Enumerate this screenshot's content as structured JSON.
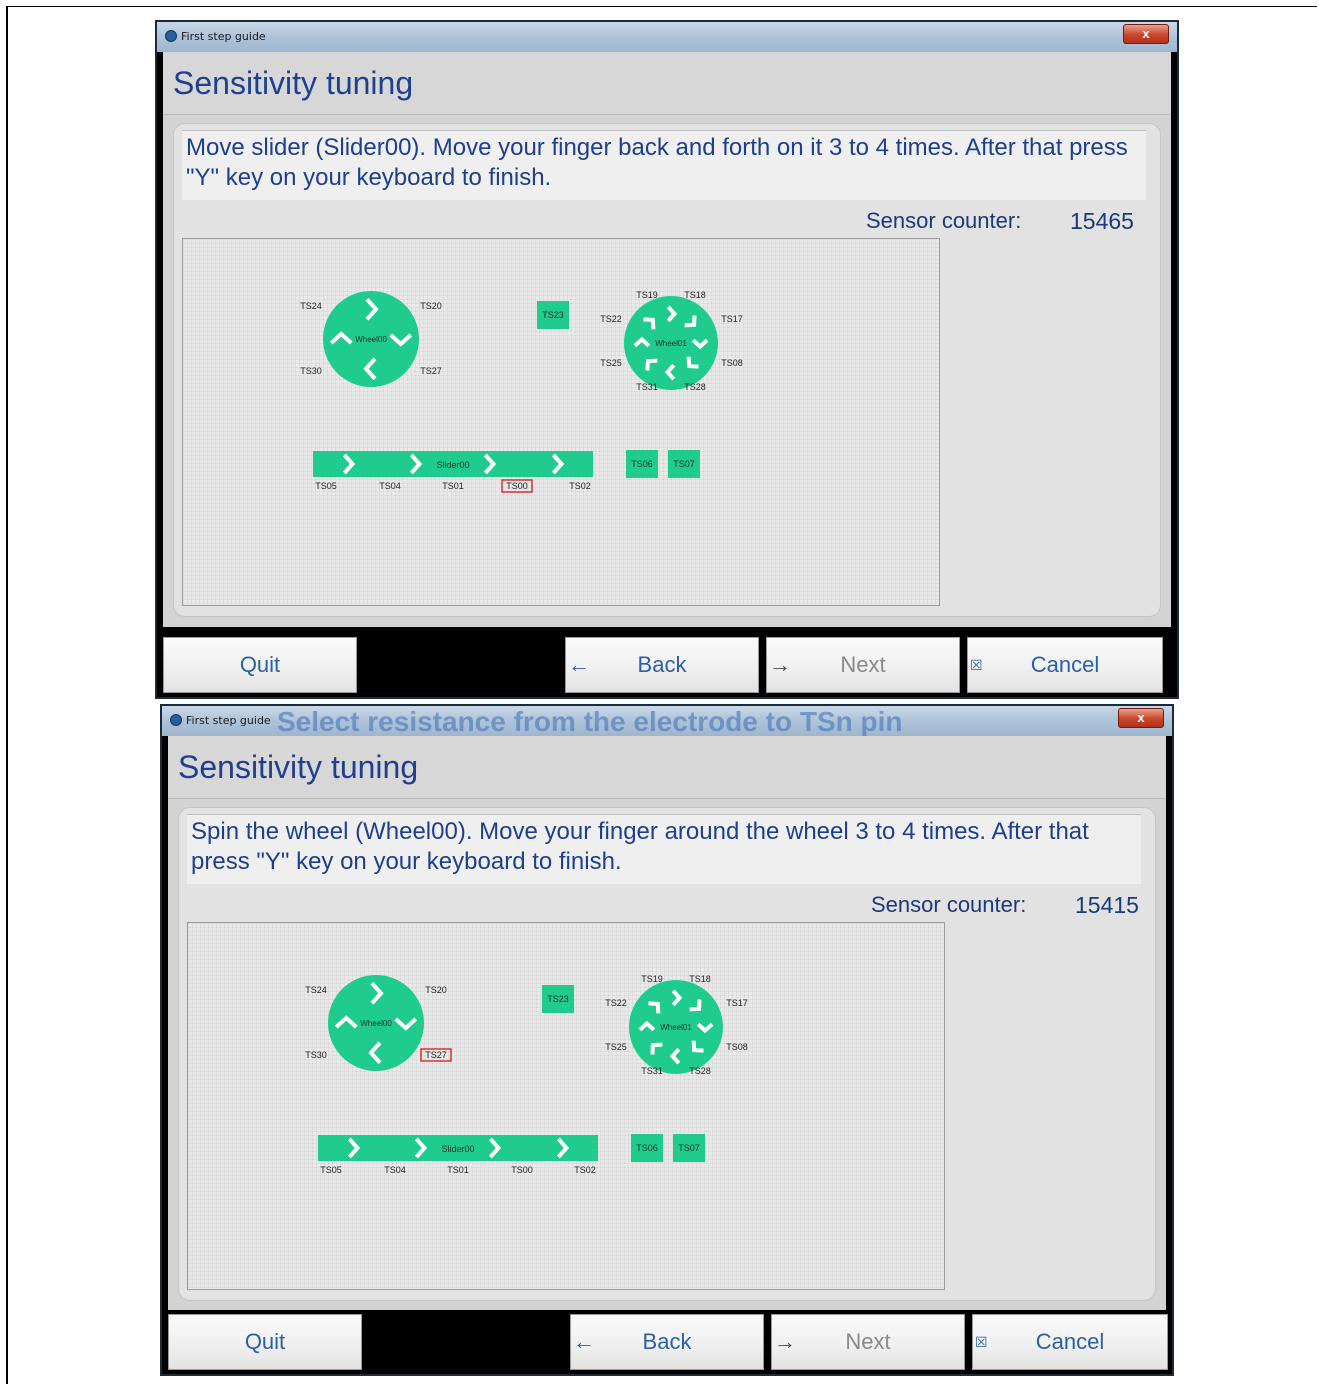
{
  "windows": [
    {
      "title_bar": {
        "title": "First step guide",
        "ghost_text": "",
        "close": "x"
      },
      "page_title": "Sensitivity tuning",
      "instruction": "Move slider (Slider00). Move your finger back and forth on it 3 to 4 times. After that press \"Y\" key on your keyboard to finish.",
      "sensor_counter_label": "Sensor counter:",
      "sensor_counter_value": "15465",
      "highlighted_sensor": "TS00",
      "buttons": {
        "quit": "Quit",
        "back": "Back",
        "next": "Next",
        "cancel": "Cancel"
      }
    },
    {
      "title_bar": {
        "title": "First step guide",
        "ghost_text": "Select resistance from the electrode to TSn pin",
        "close": "x"
      },
      "page_title": "Sensitivity tuning",
      "instruction": "Spin the wheel (Wheel00). Move your finger around the wheel 3 to 4 times. After that press \"Y\" key on your keyboard to finish.",
      "sensor_counter_label": "Sensor counter:",
      "sensor_counter_value": "15415",
      "highlighted_sensor": "TS27",
      "buttons": {
        "quit": "Quit",
        "back": "Back",
        "next": "Next",
        "cancel": "Cancel"
      }
    }
  ],
  "diagram": {
    "wheel00": {
      "name": "Wheel00",
      "labels": [
        "TS24",
        "TS20",
        "TS30",
        "TS27"
      ]
    },
    "wheel01": {
      "name": "Wheel01",
      "labels": [
        "TS19",
        "TS18",
        "TS22",
        "TS17",
        "TS25",
        "TS08",
        "TS31",
        "TS28"
      ]
    },
    "slider00": {
      "name": "Slider00",
      "labels": [
        "TS05",
        "TS04",
        "TS01",
        "TS00",
        "TS02"
      ]
    },
    "buttons": [
      "TS23",
      "TS06",
      "TS07"
    ]
  },
  "colors": {
    "electrode": "#1fcc8e",
    "highlight": "#d11a1a",
    "link_text": "#2b5fa8"
  }
}
